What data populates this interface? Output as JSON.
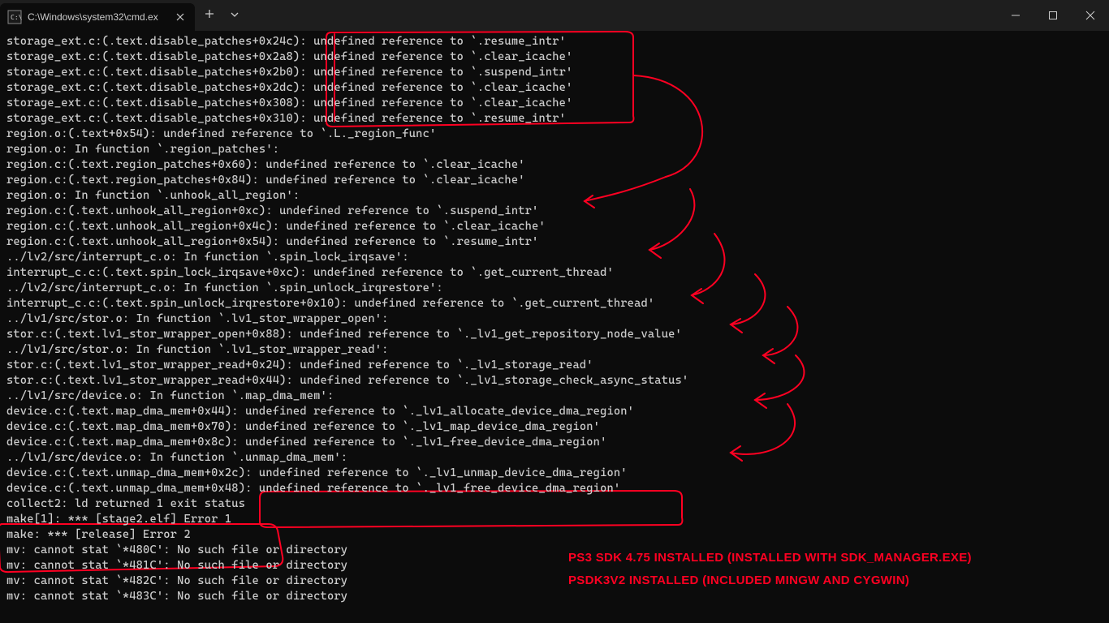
{
  "titlebar": {
    "tab_title": "C:\\Windows\\system32\\cmd.ex",
    "new_tab_tooltip": "New Tab",
    "dropdown_tooltip": "New Tab Dropdown"
  },
  "terminal_lines": [
    "storage_ext.c:(.text.disable_patches+0x24c): undefined reference to `.resume_intr'",
    "storage_ext.c:(.text.disable_patches+0x2a8): undefined reference to `.clear_icache'",
    "storage_ext.c:(.text.disable_patches+0x2b0): undefined reference to `.suspend_intr'",
    "storage_ext.c:(.text.disable_patches+0x2dc): undefined reference to `.clear_icache'",
    "storage_ext.c:(.text.disable_patches+0x308): undefined reference to `.clear_icache'",
    "storage_ext.c:(.text.disable_patches+0x310): undefined reference to `.resume_intr'",
    "region.o:(.text+0x54): undefined reference to `.L._region_func'",
    "region.o: In function `.region_patches':",
    "region.c:(.text.region_patches+0x60): undefined reference to `.clear_icache'",
    "region.c:(.text.region_patches+0x84): undefined reference to `.clear_icache'",
    "region.o: In function `.unhook_all_region':",
    "region.c:(.text.unhook_all_region+0xc): undefined reference to `.suspend_intr'",
    "region.c:(.text.unhook_all_region+0x4c): undefined reference to `.clear_icache'",
    "region.c:(.text.unhook_all_region+0x54): undefined reference to `.resume_intr'",
    "../lv2/src/interrupt_c.o: In function `.spin_lock_irqsave':",
    "interrupt_c.c:(.text.spin_lock_irqsave+0xc): undefined reference to `.get_current_thread'",
    "../lv2/src/interrupt_c.o: In function `.spin_unlock_irqrestore':",
    "interrupt_c.c:(.text.spin_unlock_irqrestore+0x10): undefined reference to `.get_current_thread'",
    "../lv1/src/stor.o: In function `.lv1_stor_wrapper_open':",
    "stor.c:(.text.lv1_stor_wrapper_open+0x88): undefined reference to `._lv1_get_repository_node_value'",
    "../lv1/src/stor.o: In function `.lv1_stor_wrapper_read':",
    "stor.c:(.text.lv1_stor_wrapper_read+0x24): undefined reference to `._lv1_storage_read'",
    "stor.c:(.text.lv1_stor_wrapper_read+0x44): undefined reference to `._lv1_storage_check_async_status'",
    "../lv1/src/device.o: In function `.map_dma_mem':",
    "device.c:(.text.map_dma_mem+0x44): undefined reference to `._lv1_allocate_device_dma_region'",
    "device.c:(.text.map_dma_mem+0x70): undefined reference to `._lv1_map_device_dma_region'",
    "device.c:(.text.map_dma_mem+0x8c): undefined reference to `._lv1_free_device_dma_region'",
    "../lv1/src/device.o: In function `.unmap_dma_mem':",
    "device.c:(.text.unmap_dma_mem+0x2c): undefined reference to `._lv1_unmap_device_dma_region'",
    "device.c:(.text.unmap_dma_mem+0x48): undefined reference to `._lv1_free_device_dma_region'",
    "collect2: ld returned 1 exit status",
    "make[1]: *** [stage2.elf] Error 1",
    "make: *** [release] Error 2",
    "mv: cannot stat `*480C': No such file or directory",
    "mv: cannot stat `*481C': No such file or directory",
    "mv: cannot stat `*482C': No such file or directory",
    "mv: cannot stat `*483C': No such file or directory"
  ],
  "annotations": {
    "note1": "PS3 SDK 4.75 INSTALLED (INSTALLED WITH SDK_MANAGER.EXE)",
    "note2": "PSDK3V2 INSTALLED (INCLUDED MINGW AND CYGWIN)"
  }
}
